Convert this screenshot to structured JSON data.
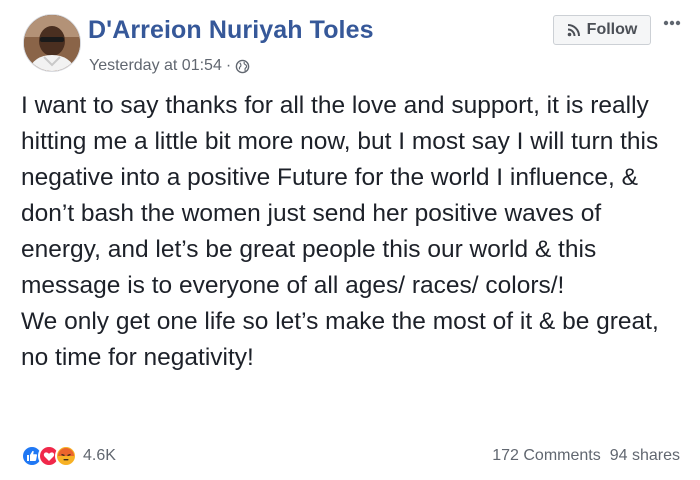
{
  "post": {
    "author": "D'Arreion Nuriyah Toles",
    "timestamp": "Yesterday at 01:54",
    "separator": "·",
    "privacy_icon": "globe-icon",
    "follow_label": "Follow",
    "more_label": "•••",
    "paragraphs": [
      "I want to say thanks for all the love and support, it is really hitting me a little bit more now, but I most say I will turn this negative into a positive Future for the world I influence, & don’t bash the women just send her positive waves of energy, and let’s be great people this our world & this message is to everyone of all ages/ races/ colors/!",
      "We only get one life so let’s make the most of it & be great, no time for negativity!"
    ]
  },
  "reactions": {
    "icons": [
      "like-icon",
      "love-icon",
      "angry-icon"
    ],
    "count": "4.6K"
  },
  "stats": {
    "comments": "172 Comments",
    "shares": "94 shares"
  },
  "colors": {
    "author_link": "#365899",
    "meta_text": "#616770",
    "like": "#2078f4",
    "love": "#f0284a",
    "angry": "#f7b125"
  }
}
